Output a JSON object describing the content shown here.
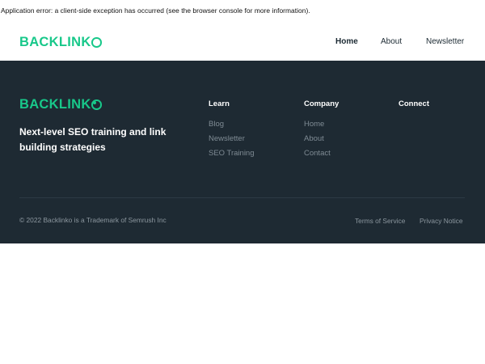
{
  "error_message": "Application error: a client-side exception has occurred (see the browser console for more information).",
  "brand": {
    "name_prefix": "BACKLINK",
    "accent_color": "#18c88a"
  },
  "nav": {
    "items": [
      {
        "label": "Home",
        "active": true
      },
      {
        "label": "About",
        "active": false
      },
      {
        "label": "Newsletter",
        "active": false
      }
    ]
  },
  "footer": {
    "background": "#1e2a33",
    "tagline": "Next-level SEO training and link building strategies",
    "columns": [
      {
        "heading": "Learn",
        "links": [
          "Blog",
          "Newsletter",
          "SEO Training"
        ]
      },
      {
        "heading": "Company",
        "links": [
          "Home",
          "About",
          "Contact"
        ]
      },
      {
        "heading": "Connect",
        "links": []
      }
    ],
    "copyright": "© 2022 Backlinko is a Trademark of Semrush Inc",
    "legal": {
      "terms": "Terms of Service",
      "privacy": "Privacy Notice"
    }
  }
}
